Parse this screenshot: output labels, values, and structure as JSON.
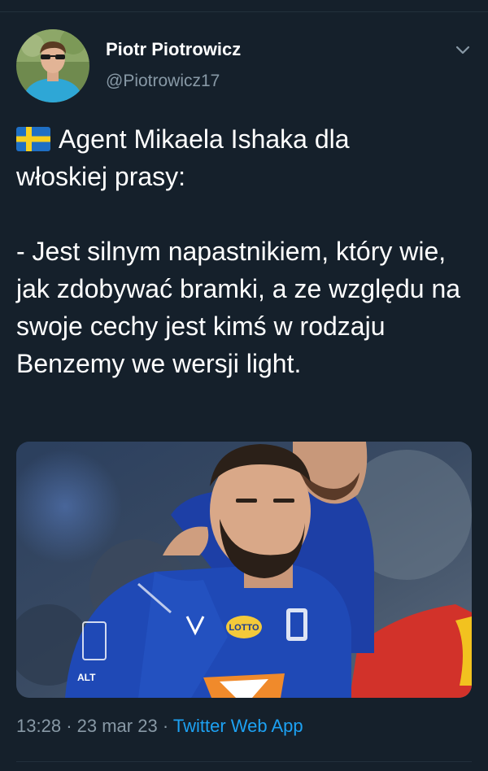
{
  "author": {
    "display_name": "Piotr Piotrowicz",
    "handle": "@Piotrowicz17"
  },
  "tweet": {
    "flag_icon": "sweden-flag-icon",
    "line1_rest": "Agent Mikaela Ishaka dla",
    "line2": "włoskiej prasy:",
    "quote": "- Jest silnym napastnikiem, który wie, jak zdobywać bramki, a ze względu na swoje cechy jest kimś w rodzaju Benzemy we wersji light."
  },
  "media": {
    "sponsor_badge": "LOTTO",
    "sleeve_text": "ALT"
  },
  "meta": {
    "time": "13:28",
    "separator": "·",
    "date": "23 mar 23",
    "source": "Twitter Web App"
  },
  "colors": {
    "background": "#15202b",
    "secondary_text": "#8899a6",
    "link": "#1da1f2",
    "jersey": "#1f49b6"
  }
}
